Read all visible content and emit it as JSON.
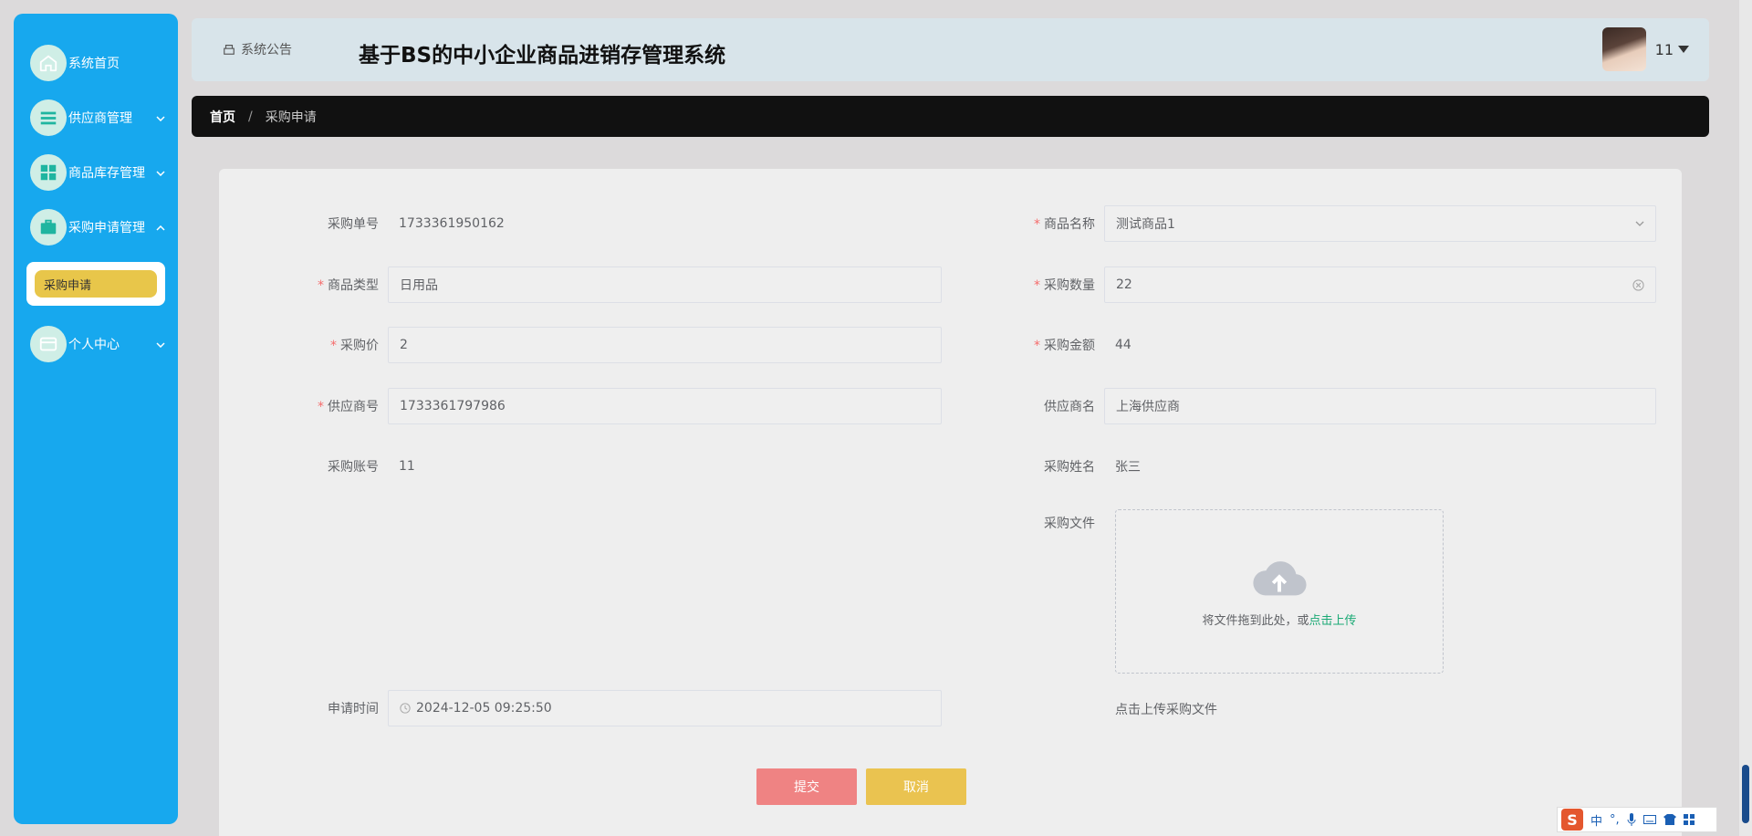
{
  "sidebar": {
    "items": [
      {
        "label": "系统首页"
      },
      {
        "label": "供应商管理"
      },
      {
        "label": "商品库存管理"
      },
      {
        "label": "采购申请管理"
      },
      {
        "label": "个人中心"
      }
    ],
    "submenu": {
      "label": "采购申请"
    }
  },
  "header": {
    "notice": "系统公告",
    "title": "基于BS的中小企业商品进销存管理系统",
    "user": "11"
  },
  "breadcrumb": {
    "home": "首页",
    "sep": "/",
    "current": "采购申请"
  },
  "form": {
    "order_no": {
      "label": "采购单号",
      "value": "1733361950162"
    },
    "product_name": {
      "label": "商品名称",
      "value": "测试商品1"
    },
    "product_type": {
      "label": "商品类型",
      "value": "日用品"
    },
    "quantity": {
      "label": "采购数量",
      "value": "22"
    },
    "price": {
      "label": "采购价",
      "value": "2"
    },
    "amount": {
      "label": "采购金额",
      "value": "44"
    },
    "supplier_no": {
      "label": "供应商号",
      "value": "1733361797986"
    },
    "supplier_name": {
      "label": "供应商名",
      "value": "上海供应商"
    },
    "account": {
      "label": "采购账号",
      "value": "11"
    },
    "buyer_name": {
      "label": "采购姓名",
      "value": "张三"
    },
    "file": {
      "label": "采购文件",
      "drop_text": "将文件拖到此处，或",
      "click_text": "点击上传",
      "tip": "点击上传采购文件"
    },
    "apply_time": {
      "label": "申请时间",
      "value": "2024-12-05 09:25:50"
    },
    "submit": "提交",
    "cancel": "取消"
  },
  "ime": {
    "logo": "S",
    "mode": "中",
    "punct": "°,"
  }
}
